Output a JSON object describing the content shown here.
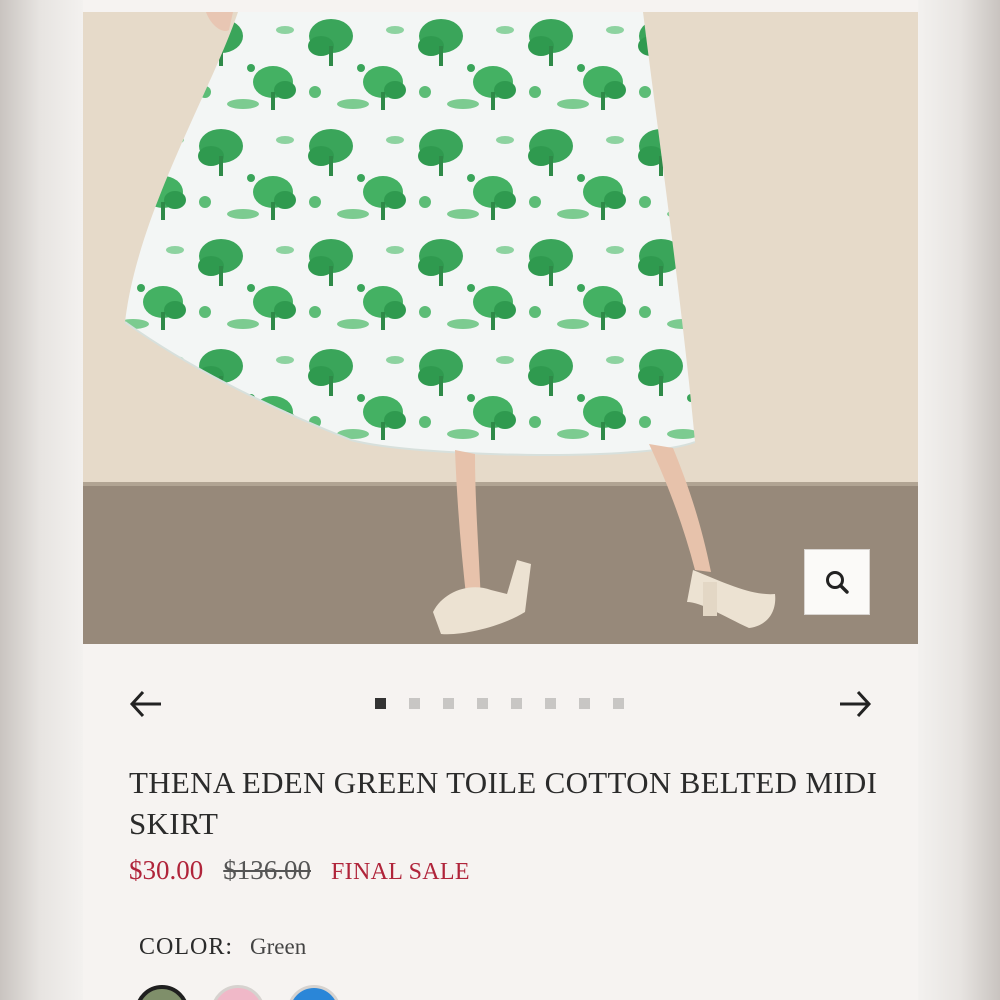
{
  "product": {
    "title": "THENA EDEN GREEN TOILE COTTON BELTED MIDI SKIRT",
    "sale_price": "$30.00",
    "original_price": "$136.00",
    "badge": "FINAL SALE"
  },
  "gallery": {
    "image_alt": "Model wearing green toile midi skirt with cream slingback heels",
    "zoom_icon": "magnifier-icon",
    "prev_icon": "arrow-left-icon",
    "next_icon": "arrow-right-icon",
    "total_images": 8,
    "active_index": 0
  },
  "color": {
    "label": "COLOR:",
    "selected": "Green",
    "swatches": [
      {
        "name": "Green",
        "hex": "#7f8f6a",
        "selected": true
      },
      {
        "name": "Pink",
        "hex": "#f0b8c8",
        "selected": false
      },
      {
        "name": "Blue",
        "hex": "#2a86d8",
        "selected": false
      }
    ]
  },
  "colors": {
    "sale": "#b0243a",
    "text": "#2b2b2b",
    "background": "#f6f3f1"
  }
}
